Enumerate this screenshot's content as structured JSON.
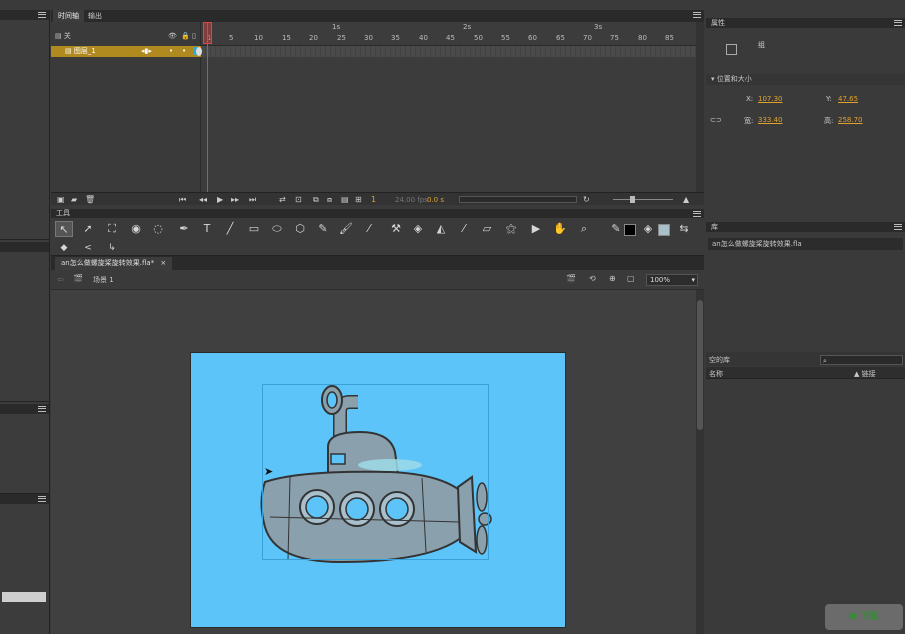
{
  "timeline": {
    "tabs": [
      "时间轴",
      "输出"
    ],
    "layers": [
      {
        "name": "关"
      },
      {
        "name": "图层_1",
        "selected": true
      }
    ],
    "seconds": [
      "1s",
      "2s",
      "3s"
    ],
    "ticks": [
      "1",
      "5",
      "10",
      "15",
      "20",
      "25",
      "30",
      "35",
      "40",
      "45",
      "50",
      "55",
      "60",
      "65",
      "70",
      "75",
      "80",
      "85"
    ],
    "current_frame": "1",
    "fps": "24.00 fps",
    "time": "0.0 s"
  },
  "tools": {
    "title": "工具"
  },
  "document": {
    "tab": "an怎么做螺旋桨旋转效果.fla*",
    "scene": "场景 1",
    "zoom": "100%"
  },
  "properties": {
    "title": "属性",
    "group_label": "组",
    "section": "位置和大小",
    "x_label": "X:",
    "x_value": "107.30",
    "y_label": "Y:",
    "y_value": "47.65",
    "w_label": "宽:",
    "w_value": "333.40",
    "h_label": "高:",
    "h_value": "258.70"
  },
  "library": {
    "title": "库",
    "file": "an怎么做螺旋桨旋转效果.fla",
    "empty_label": "空的库",
    "col_name": "名称",
    "col_link": "▲ 链接"
  },
  "colors": {
    "stage": "#5cc4f8",
    "selection": "#b08a1e",
    "playhead": "#e04040",
    "value": "#e0a030"
  }
}
